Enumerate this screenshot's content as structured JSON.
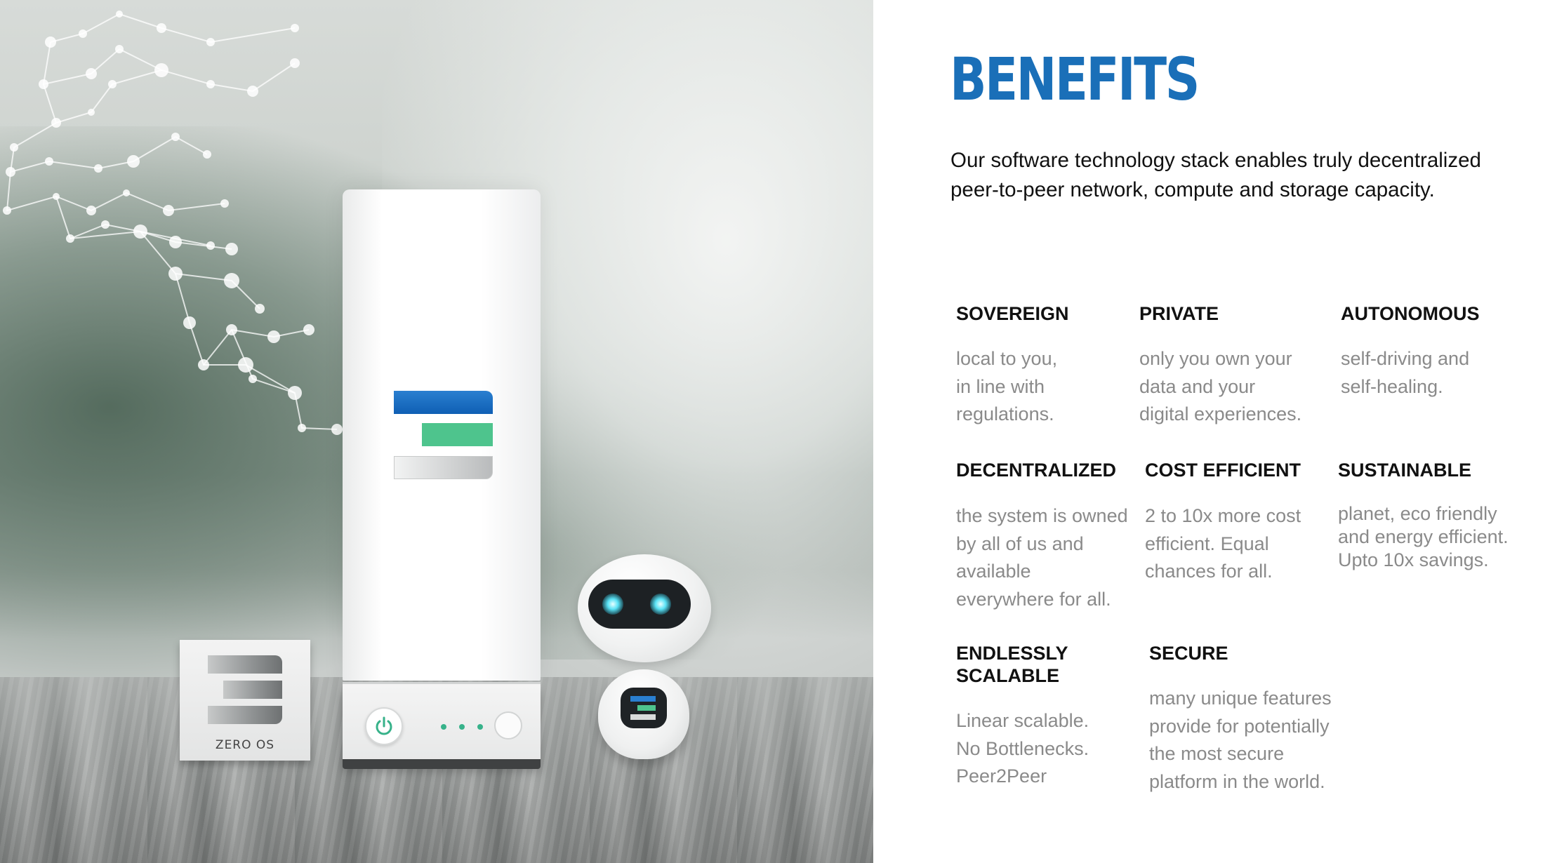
{
  "slide": {
    "title": "BENEFITS",
    "intro": "Our software technology stack enables truly decentralized peer-to-peer network, compute and storage capacity.",
    "accent_color": "#1a6fb8"
  },
  "image": {
    "box_label": "ZERO OS"
  },
  "benefits": [
    {
      "title": "SOVEREIGN",
      "desc": "local to you,\nin line with\nregulations."
    },
    {
      "title": "PRIVATE",
      "desc": "only you own your\ndata and your\ndigital experiences."
    },
    {
      "title": "AUTONOMOUS",
      "desc": "self-driving and\nself-healing."
    },
    {
      "title": "DECENTRALIZED",
      "desc": "the system is owned\nby all of us and\navailable\neverywhere for all."
    },
    {
      "title": "COST EFFICIENT",
      "desc": "2 to 10x more cost\nefficient. Equal\nchances for all."
    },
    {
      "title": "SUSTAINABLE",
      "desc": "planet, eco friendly\nand energy efficient.\nUpto 10x savings."
    },
    {
      "title": "ENDLESSLY\nSCALABLE",
      "desc": "Linear scalable.\nNo Bottlenecks.\nPeer2Peer"
    },
    {
      "title": "SECURE",
      "desc": "many unique features\nprovide for potentially\nthe most secure\nplatform in the world."
    }
  ]
}
